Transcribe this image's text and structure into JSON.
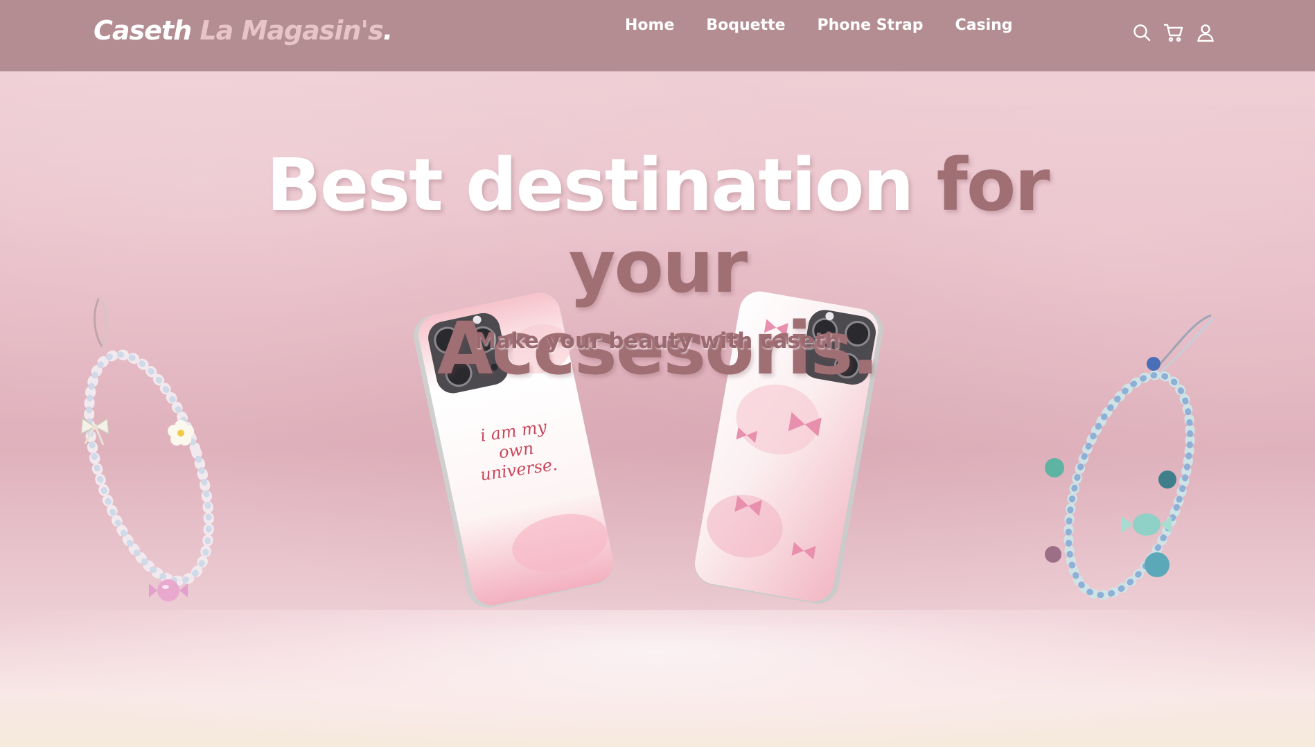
{
  "brand": {
    "name_part1": "Caseth",
    "name_part2": "La Magasin's",
    "name_dot": "."
  },
  "nav": {
    "links": [
      "Home",
      "Boquette",
      "Phone Strap",
      "Casing"
    ],
    "icons": [
      "search-icon",
      "cart-icon",
      "user-icon"
    ]
  },
  "hero": {
    "title_white": "Best destination",
    "title_dark_line1": "for your",
    "title_dark_line2": "Accsesoris.",
    "subtitle": "Make your beauty with caseth",
    "case_text": "i am my own universe."
  },
  "colors": {
    "navbar": "#b48d92",
    "title_dark": "#a06f74",
    "background": "#e8bcc6",
    "logo_accent": "#e8c4c8"
  }
}
